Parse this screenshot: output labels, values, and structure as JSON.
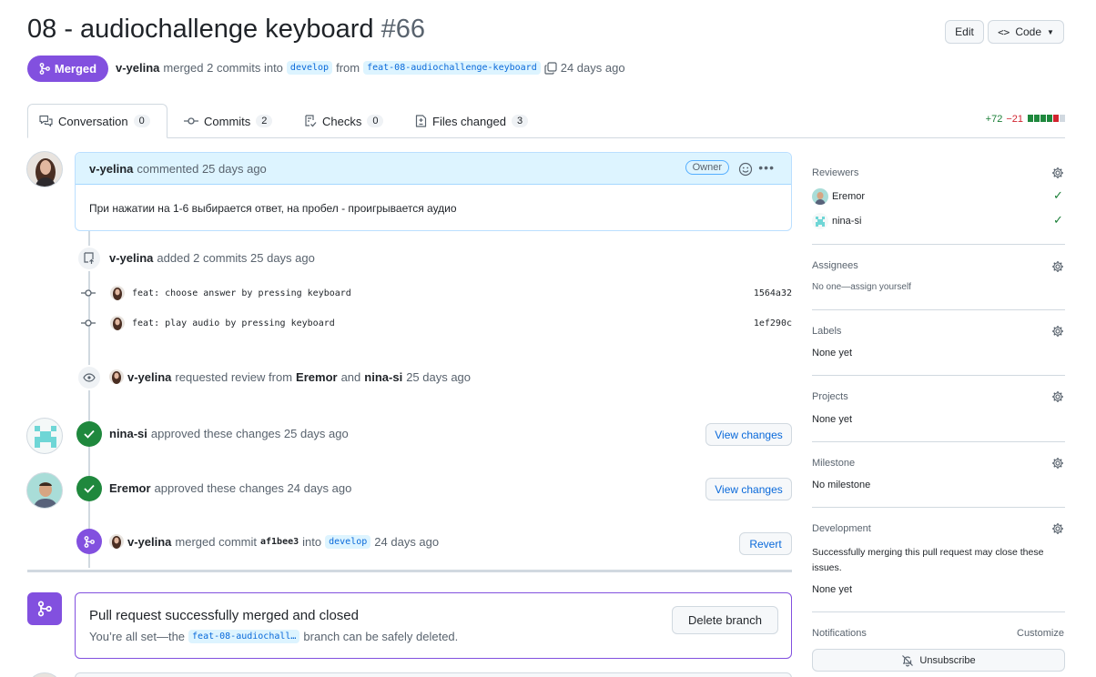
{
  "header": {
    "title": "08 - audiochallenge keyboard",
    "number": "#66",
    "edit_label": "Edit",
    "code_label": "Code"
  },
  "status": {
    "badge": "Merged",
    "author": "v-yelina",
    "text_merged": "merged 2 commits into",
    "base_branch": "develop",
    "text_from": "from",
    "head_branch": "feat-08-audiochallenge-keyboard",
    "time": "24 days ago"
  },
  "tabs": [
    {
      "label": "Conversation",
      "count": "0"
    },
    {
      "label": "Commits",
      "count": "2"
    },
    {
      "label": "Checks",
      "count": "0"
    },
    {
      "label": "Files changed",
      "count": "3"
    }
  ],
  "diffstat": {
    "additions": "+72",
    "deletions": "−21"
  },
  "comment": {
    "author": "v-yelina",
    "action": "commented 25 days ago",
    "role": "Owner",
    "body": "При нажатии на 1-6 выбирается ответ, на пробел - проигрывается аудио"
  },
  "timeline": {
    "commits_event": {
      "author": "v-yelina",
      "text": "added 2 commits 25 days ago"
    },
    "commits": [
      {
        "message": "feat: choose answer by pressing keyboard",
        "sha": "1564a32"
      },
      {
        "message": "feat: play audio by pressing keyboard",
        "sha": "1ef290c"
      }
    ],
    "review_request": {
      "author": "v-yelina",
      "text1": "requested review from",
      "r1": "Eremor",
      "and": "and",
      "r2": "nina-si",
      "time": "25 days ago"
    },
    "approvals": [
      {
        "author": "nina-si",
        "text": "approved these changes 25 days ago",
        "button": "View changes"
      },
      {
        "author": "Eremor",
        "text": "approved these changes 24 days ago",
        "button": "View changes"
      }
    ],
    "merge_event": {
      "author": "v-yelina",
      "text": "merged commit",
      "sha": "af1bee3",
      "into": "into",
      "branch": "develop",
      "time": "24 days ago",
      "button": "Revert"
    }
  },
  "merged_box": {
    "title": "Pull request successfully merged and closed",
    "text1": "You’re all set—the",
    "branch": "feat-08-audiochall…",
    "text2": "branch can be safely deleted.",
    "button": "Delete branch"
  },
  "sidebar": {
    "reviewers_label": "Reviewers",
    "reviewers": [
      "Eremor",
      "nina-si"
    ],
    "assignees_label": "Assignees",
    "assignees_value": "No one—assign yourself",
    "labels_label": "Labels",
    "labels_value": "None yet",
    "projects_label": "Projects",
    "projects_value": "None yet",
    "milestone_label": "Milestone",
    "milestone_value": "No milestone",
    "development_label": "Development",
    "development_text": "Successfully merging this pull request may close these issues.",
    "development_value": "None yet",
    "notifications_label": "Notifications",
    "customize_label": "Customize",
    "unsubscribe_label": "Unsubscribe"
  },
  "colors": {
    "merged": "#8250df",
    "approved": "#1f883d",
    "link": "#0969da"
  }
}
